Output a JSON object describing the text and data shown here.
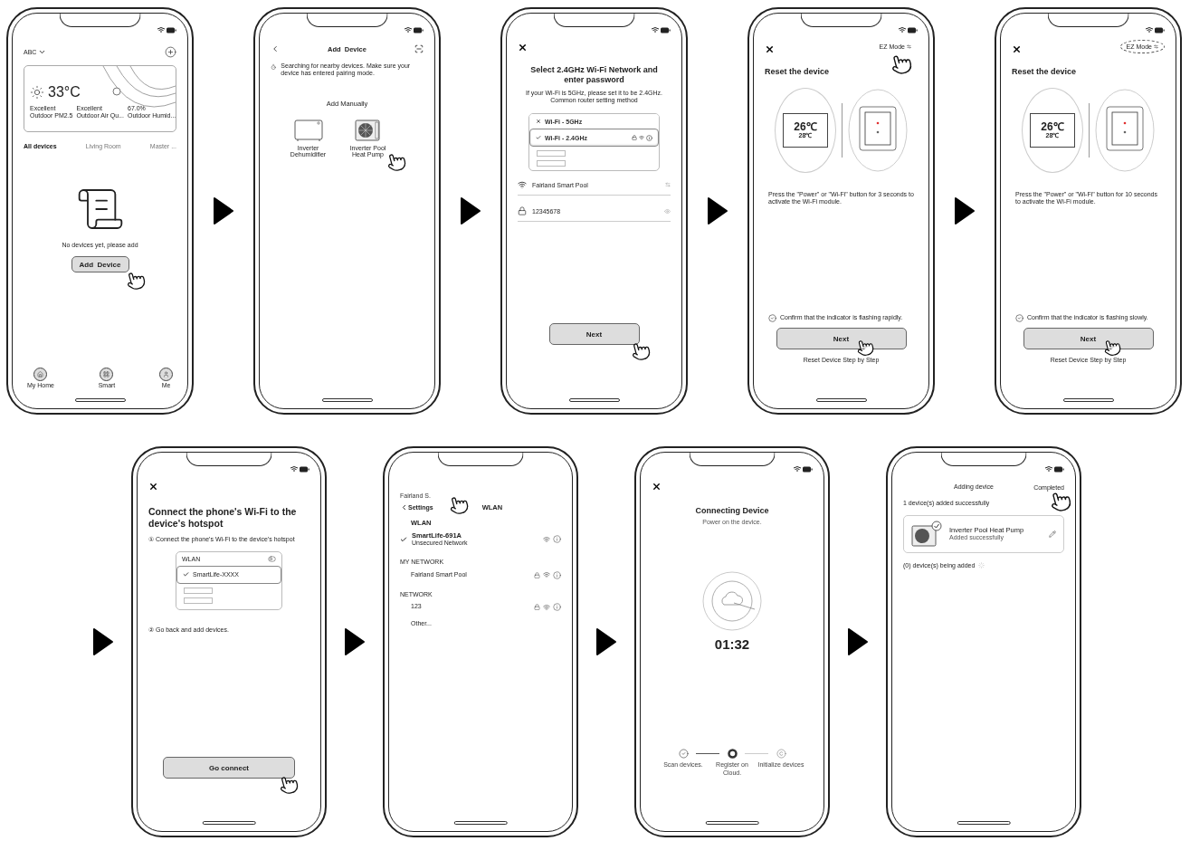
{
  "rows": [
    {
      "leading_arrow": false,
      "screens": [
        {
          "kind": "home",
          "status_bar": true,
          "home_name": "ABC",
          "weather": {
            "temp": "33°C",
            "stats": [
              {
                "value": "Excellent",
                "label": "Outdoor PM2.5"
              },
              {
                "value": "Excellent",
                "label": "Outdoor Air Qu..."
              },
              {
                "value": "67.0%",
                "label": "Outdoor Humid..."
              }
            ]
          },
          "rooms": [
            {
              "label": "All devices",
              "selected": true
            },
            {
              "label": "Living Room",
              "selected": false
            },
            {
              "label": "Master ...",
              "selected": false
            }
          ],
          "empty_text": "No devices yet, please add",
          "button": {
            "label": "Add  Device",
            "tapped": true
          },
          "nav": [
            {
              "label": "My Home"
            },
            {
              "label": "Smart"
            },
            {
              "label": "Me"
            }
          ]
        },
        {
          "kind": "add_device",
          "status_bar": true,
          "title": "Add  Device",
          "notice": "Searching for nearby devices. Make sure your device has entered pairing mode.",
          "section": "Add Manually",
          "devices": [
            {
              "name": "Inverter Dehumidifier",
              "tapped": false
            },
            {
              "name": "Inverter Pool Heat Pump",
              "tapped": true
            }
          ]
        },
        {
          "kind": "wifi_select",
          "status_bar": true,
          "title": "Select 2.4GHz Wi-Fi Network and enter password",
          "hint": "If your Wi-Fi is 5GHz, please set it to be 2.4GHz. Common router setting method",
          "networks": [
            {
              "name": "Wi-Fi - 5GHz",
              "selected": false
            },
            {
              "name": "Wi-Fi - 2.4GHz",
              "selected": true
            }
          ],
          "ssid": "Fairland Smart Pool",
          "password": "12345678",
          "button": {
            "label": "Next",
            "tapped": true
          }
        },
        {
          "kind": "reset",
          "status_bar": true,
          "mode": {
            "label": "EZ Mode",
            "tapped": true,
            "highlighted": false
          },
          "title": "Reset the device",
          "display": {
            "main": "26℃",
            "sub": "28℃"
          },
          "instruction": "Press the \"Power\" or \"Wi-Fi\" button for 3 seconds to activate the Wi-Fi module.",
          "confirm": {
            "text": "Confirm that the indicator is flashing rapidly.",
            "checked": true
          },
          "button": {
            "label": "Next",
            "tapped": true
          },
          "link": "Reset Device Step by Step"
        },
        {
          "kind": "reset",
          "status_bar": true,
          "mode": {
            "label": "EZ Mode",
            "tapped": false,
            "highlighted": true
          },
          "title": "Reset the device",
          "display": {
            "main": "26℃",
            "sub": "28℃"
          },
          "instruction": "Press the \"Power\" or \"Wi-Fi\" button for 10 seconds to activate the Wi-Fi module.",
          "confirm": {
            "text": "Confirm that the indicator is flashing slowly.",
            "checked": true
          },
          "button": {
            "label": "Next",
            "tapped": true
          },
          "link": "Reset Device Step by Step"
        }
      ]
    },
    {
      "leading_arrow": true,
      "screens": [
        {
          "kind": "hotspot",
          "status_bar": true,
          "title": "Connect the phone's Wi-Fi to the device's hotspot",
          "step_1": "① Connect the phone's Wi-Fi to the device's hotspot",
          "illustration": {
            "header": "WLAN",
            "network": "SmartLife-XXXX"
          },
          "step_2": "② Go back and add devices.",
          "button": {
            "label": "Go connect",
            "tapped": true
          }
        },
        {
          "kind": "wlan_settings",
          "status_bar": false,
          "return_app": {
            "label": "Fairland S.",
            "tapped": true
          },
          "back": "Settings",
          "title": "WLAN",
          "section": "WLAN",
          "connected": {
            "name": "SmartLife-691A",
            "note": "Unsecured Network",
            "locked": false
          },
          "groups": [
            {
              "heading": "MY NETWORK",
              "networks": [
                {
                  "kind": "network",
                  "name": "Fairland Smart Pool",
                  "locked": true
                }
              ]
            },
            {
              "heading": "NETWORK",
              "networks": [
                {
                  "kind": "network",
                  "name": "123",
                  "locked": true
                },
                {
                  "kind": "other",
                  "name": "Other..."
                }
              ]
            }
          ]
        },
        {
          "kind": "connecting",
          "status_bar": true,
          "title": "Connecting Device",
          "subtitle": "Power on the device.",
          "timer": "01:32",
          "steps": [
            {
              "label": "Scan devices.",
              "done": true,
              "active": false
            },
            {
              "label": "Register on Cloud.",
              "done": false,
              "active": true
            },
            {
              "label": "Initialize devices",
              "done": false,
              "active": false
            }
          ]
        },
        {
          "kind": "completed",
          "status_bar": true,
          "title": "Adding device",
          "action": {
            "label": "Completed",
            "tapped": true
          },
          "success_count": "1 device(s) added successfully",
          "devices": [
            {
              "name": "Inverter Pool Heat Pump",
              "status": "Added successfully"
            }
          ],
          "pending_count": "(0) device(s) being added"
        }
      ]
    }
  ]
}
